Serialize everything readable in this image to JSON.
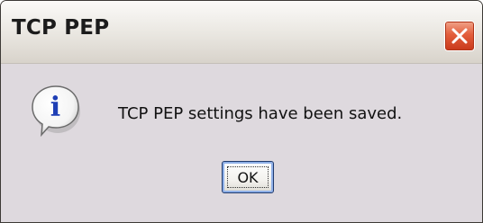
{
  "window": {
    "title": "TCP PEP",
    "close_icon": "close-icon"
  },
  "dialog": {
    "icon": "info-icon",
    "icon_glyph": "i",
    "message": "TCP PEP settings have been saved.",
    "ok_label": "OK"
  },
  "colors": {
    "window_bg": "#ded9de",
    "titlebar_bg": "#ece9e3",
    "close_button": "#e0573a",
    "info_icon_blue": "#1f3fb5"
  }
}
